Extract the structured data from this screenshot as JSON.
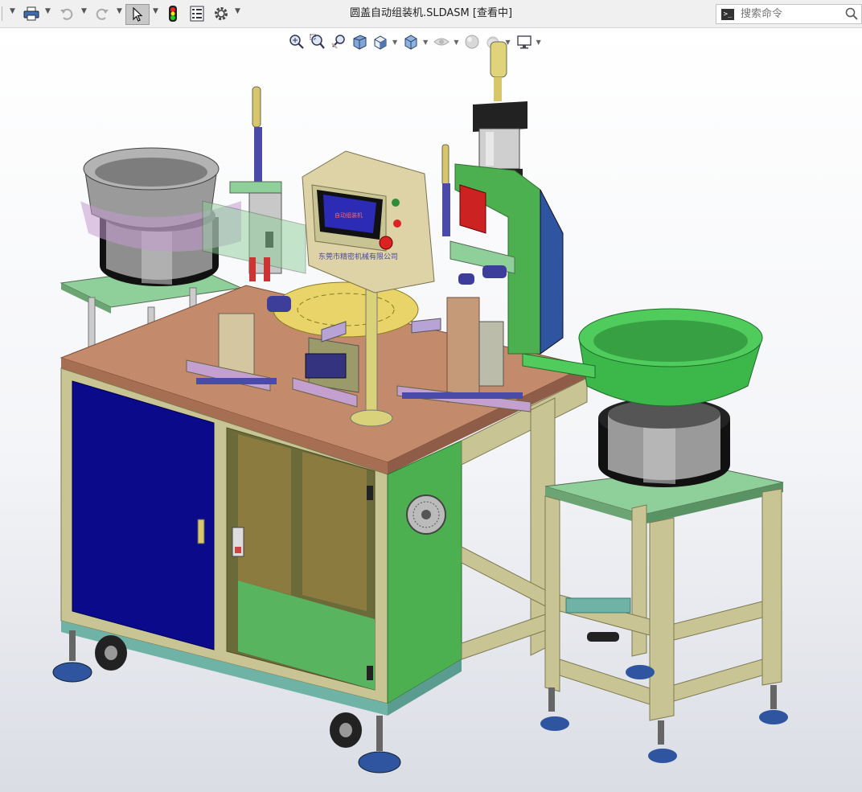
{
  "window": {
    "title": "圆盖自动组装机.SLDASM [查看中]"
  },
  "search": {
    "placeholder": "搜索命令"
  },
  "machine_panel": {
    "hmi_text": "自动组装机",
    "label": "东莞市精密机械有限公司"
  },
  "colors": {
    "toolbar_bg": "#f0f0f0",
    "table_top": "#c48a6c",
    "frame": "#c8c493",
    "door_blue": "#0a0a8a",
    "panel_green": "#4caf50",
    "bowl_green": "#3cb84a",
    "bowl_grey": "#8e8e8e"
  },
  "icons": {
    "toolbar": [
      "print-icon",
      "undo-icon",
      "redo-icon",
      "select-arrow-icon",
      "traffic-light-icon",
      "file-properties-icon",
      "options-gear-icon"
    ],
    "heads_up": [
      "zoom-fit-icon",
      "zoom-area-icon",
      "previous-view-icon",
      "section-view-icon",
      "view-orientation-icon",
      "display-style-icon",
      "hide-show-icon",
      "appearance-icon",
      "scene-icon",
      "view-settings-icon"
    ]
  }
}
